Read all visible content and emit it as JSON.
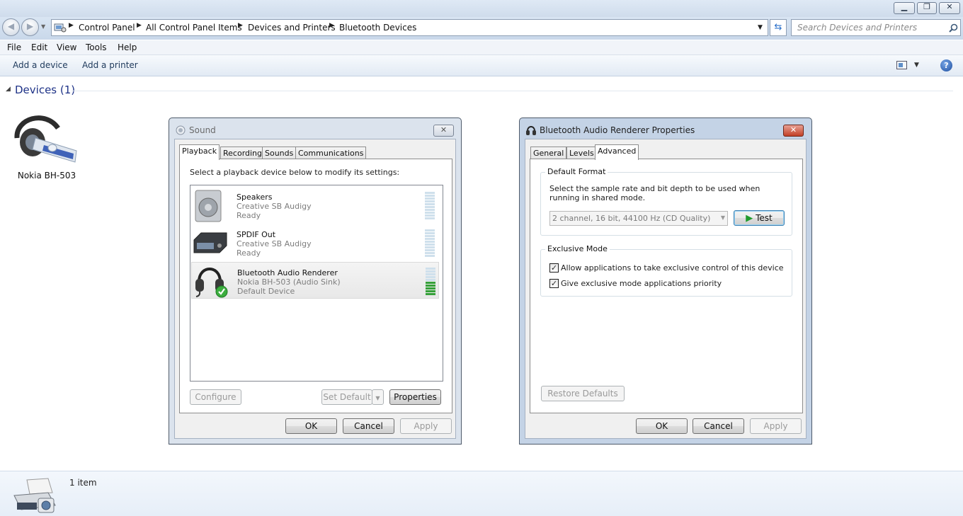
{
  "explorer": {
    "breadcrumbs": [
      "Control Panel",
      "All Control Panel Items",
      "Devices and Printers",
      "Bluetooth Devices"
    ],
    "search_placeholder": "Search Devices and Printers",
    "menu": [
      "File",
      "Edit",
      "View",
      "Tools",
      "Help"
    ],
    "commands": {
      "add_device": "Add a device",
      "add_printer": "Add a printer"
    },
    "group_title": "Devices (1)",
    "device_name": "Nokia BH-503",
    "status_count": "1 item"
  },
  "sound_dialog": {
    "title": "Sound",
    "tabs": [
      "Playback",
      "Recording",
      "Sounds",
      "Communications"
    ],
    "instruction": "Select a playback device below to modify its settings:",
    "devices": [
      {
        "name": "Speakers",
        "driver": "Creative SB Audigy",
        "status": "Ready",
        "level": 0
      },
      {
        "name": "SPDIF Out",
        "driver": "Creative SB Audigy",
        "status": "Ready",
        "level": 0
      },
      {
        "name": "Bluetooth Audio Renderer",
        "driver": "Nokia BH-503 (Audio Sink)",
        "status": "Default Device",
        "level": 0.5
      }
    ],
    "buttons": {
      "configure": "Configure",
      "set_default": "Set Default",
      "properties": "Properties",
      "ok": "OK",
      "cancel": "Cancel",
      "apply": "Apply"
    }
  },
  "props_dialog": {
    "title": "Bluetooth Audio Renderer Properties",
    "tabs": [
      "General",
      "Levels",
      "Advanced"
    ],
    "default_format": {
      "legend": "Default Format",
      "description": "Select the sample rate and bit depth to be used when running in shared mode.",
      "selected": "2 channel, 16 bit, 44100 Hz (CD Quality)",
      "test_label": "Test"
    },
    "exclusive_mode": {
      "legend": "Exclusive Mode",
      "allow_exclusive": "Allow applications to take exclusive control of this device",
      "allow_exclusive_checked": true,
      "priority": "Give exclusive mode applications priority",
      "priority_checked": true
    },
    "buttons": {
      "restore": "Restore Defaults",
      "ok": "OK",
      "cancel": "Cancel",
      "apply": "Apply"
    }
  },
  "colors": {
    "accent": "#1e3287",
    "title_active": "#c4d3e6",
    "close_red": "#c24026",
    "meter_green": "#36a03a"
  }
}
